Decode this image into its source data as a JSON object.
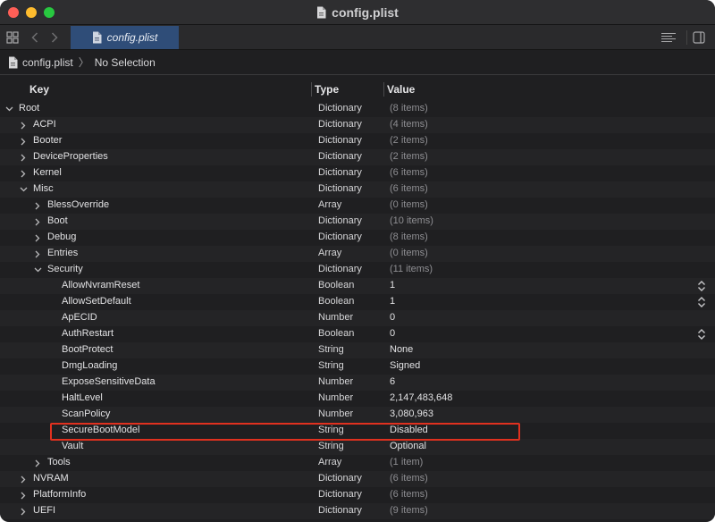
{
  "window": {
    "title": "config.plist",
    "tab_label": "config.plist"
  },
  "jumpbar": {
    "file": "config.plist",
    "selection": "No Selection"
  },
  "columns": {
    "key": "Key",
    "type": "Type",
    "value": "Value"
  },
  "rows": [
    {
      "key": "Root",
      "type": "Dictionary",
      "value": "(8 items)",
      "level": 0,
      "disclosure": "open",
      "dim": true
    },
    {
      "key": "ACPI",
      "type": "Dictionary",
      "value": "(4 items)",
      "level": 1,
      "disclosure": "closed",
      "dim": true
    },
    {
      "key": "Booter",
      "type": "Dictionary",
      "value": "(2 items)",
      "level": 1,
      "disclosure": "closed",
      "dim": true
    },
    {
      "key": "DeviceProperties",
      "type": "Dictionary",
      "value": "(2 items)",
      "level": 1,
      "disclosure": "closed",
      "dim": true
    },
    {
      "key": "Kernel",
      "type": "Dictionary",
      "value": "(6 items)",
      "level": 1,
      "disclosure": "closed",
      "dim": true
    },
    {
      "key": "Misc",
      "type": "Dictionary",
      "value": "(6 items)",
      "level": 1,
      "disclosure": "open",
      "dim": true
    },
    {
      "key": "BlessOverride",
      "type": "Array",
      "value": "(0 items)",
      "level": 2,
      "disclosure": "closed",
      "dim": true
    },
    {
      "key": "Boot",
      "type": "Dictionary",
      "value": "(10 items)",
      "level": 2,
      "disclosure": "closed",
      "dim": true
    },
    {
      "key": "Debug",
      "type": "Dictionary",
      "value": "(8 items)",
      "level": 2,
      "disclosure": "closed",
      "dim": true
    },
    {
      "key": "Entries",
      "type": "Array",
      "value": "(0 items)",
      "level": 2,
      "disclosure": "closed",
      "dim": true
    },
    {
      "key": "Security",
      "type": "Dictionary",
      "value": "(11 items)",
      "level": 2,
      "disclosure": "open",
      "dim": true
    },
    {
      "key": "AllowNvramReset",
      "type": "Boolean",
      "value": "1",
      "level": 3,
      "disclosure": "none",
      "stepper": true
    },
    {
      "key": "AllowSetDefault",
      "type": "Boolean",
      "value": "1",
      "level": 3,
      "disclosure": "none",
      "stepper": true
    },
    {
      "key": "ApECID",
      "type": "Number",
      "value": "0",
      "level": 3,
      "disclosure": "none"
    },
    {
      "key": "AuthRestart",
      "type": "Boolean",
      "value": "0",
      "level": 3,
      "disclosure": "none",
      "stepper": true
    },
    {
      "key": "BootProtect",
      "type": "String",
      "value": "None",
      "level": 3,
      "disclosure": "none"
    },
    {
      "key": "DmgLoading",
      "type": "String",
      "value": "Signed",
      "level": 3,
      "disclosure": "none"
    },
    {
      "key": "ExposeSensitiveData",
      "type": "Number",
      "value": "6",
      "level": 3,
      "disclosure": "none"
    },
    {
      "key": "HaltLevel",
      "type": "Number",
      "value": "2,147,483,648",
      "level": 3,
      "disclosure": "none"
    },
    {
      "key": "ScanPolicy",
      "type": "Number",
      "value": "3,080,963",
      "level": 3,
      "disclosure": "none"
    },
    {
      "key": "SecureBootModel",
      "type": "String",
      "value": "Disabled",
      "level": 3,
      "disclosure": "none",
      "highlighted": true
    },
    {
      "key": "Vault",
      "type": "String",
      "value": "Optional",
      "level": 3,
      "disclosure": "none"
    },
    {
      "key": "Tools",
      "type": "Array",
      "value": "(1 item)",
      "level": 2,
      "disclosure": "closed",
      "dim": true
    },
    {
      "key": "NVRAM",
      "type": "Dictionary",
      "value": "(6 items)",
      "level": 1,
      "disclosure": "closed",
      "dim": true
    },
    {
      "key": "PlatformInfo",
      "type": "Dictionary",
      "value": "(6 items)",
      "level": 1,
      "disclosure": "closed",
      "dim": true
    },
    {
      "key": "UEFI",
      "type": "Dictionary",
      "value": "(9 items)",
      "level": 1,
      "disclosure": "closed",
      "dim": true
    }
  ],
  "colors": {
    "highlight_border": "#e0311f",
    "active_tab": "#2f4d78",
    "window_bg": "#1f1f21"
  },
  "icons": {
    "file": "document-icon",
    "grid": "grid-icon",
    "back": "chevron-left-icon",
    "forward": "chevron-right-icon",
    "editor_options": "lines-icon",
    "inspector": "sidebar-toggle-icon"
  }
}
